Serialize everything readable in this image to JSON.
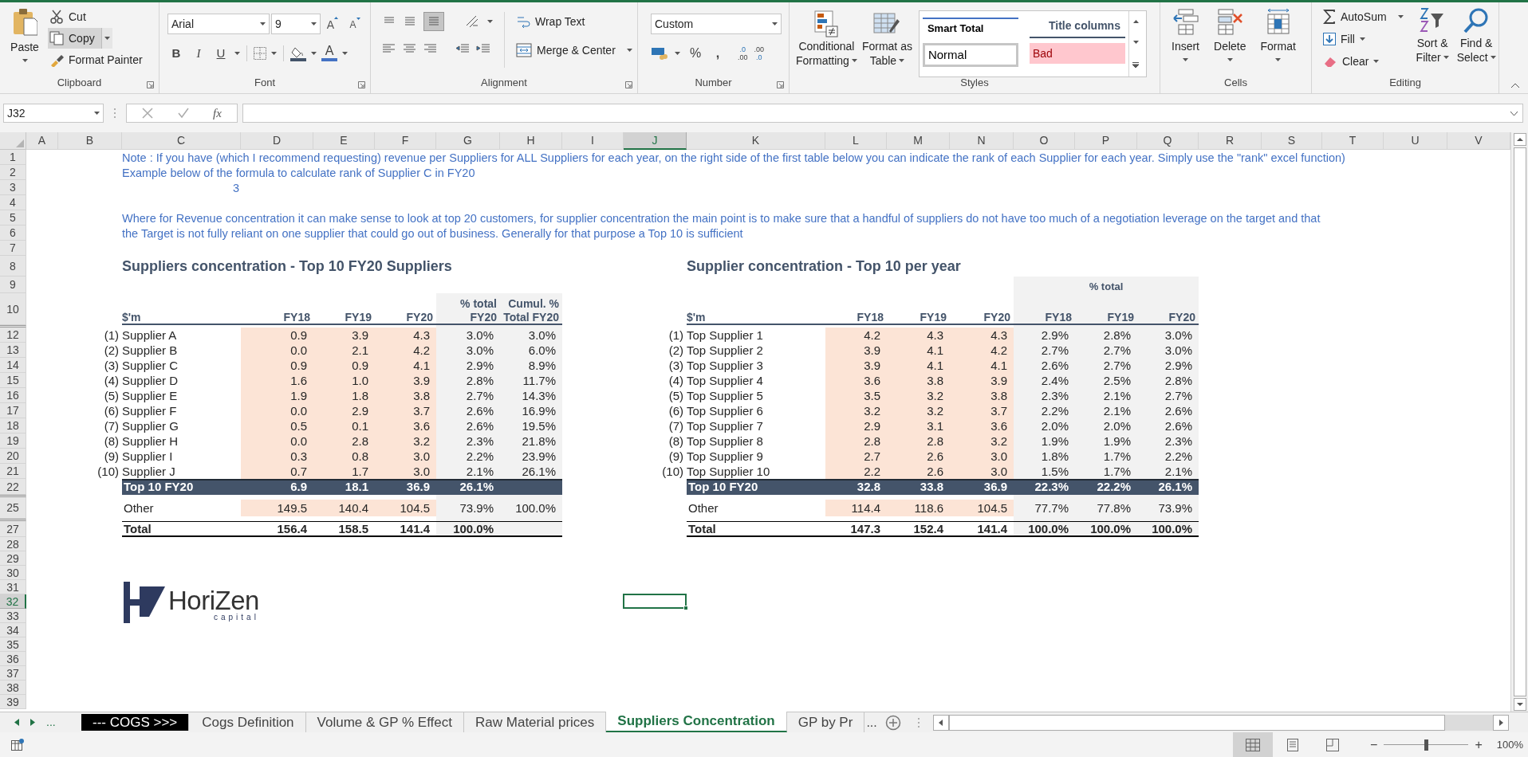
{
  "ribbon": {
    "clipboard": {
      "label": "Clipboard",
      "paste": "Paste",
      "cut": "Cut",
      "copy": "Copy",
      "format_painter": "Format Painter"
    },
    "font": {
      "label": "Font",
      "font_name": "Arial",
      "font_size": "9",
      "grow": "A",
      "shrink": "A",
      "bold": "B",
      "italic": "I",
      "underline": "U",
      "font_color": "A"
    },
    "alignment": {
      "label": "Alignment",
      "wrap_text": "Wrap Text",
      "merge_center": "Merge & Center"
    },
    "number": {
      "label": "Number",
      "format": "Custom",
      "percent": "%",
      "comma": ",",
      "increase_decimal": [
        ".0",
        ".00"
      ],
      "decrease_decimal": [
        ".00",
        ".0"
      ]
    },
    "styles": {
      "label": "Styles",
      "conditional_formatting": [
        "Conditional",
        "Formatting"
      ],
      "format_as_table": [
        "Format as",
        "Table"
      ],
      "gallery": [
        {
          "label": "Smart Total",
          "kind": "smart_total"
        },
        {
          "label": "Title columns",
          "kind": "title"
        },
        {
          "label": "Normal",
          "kind": "normal"
        },
        {
          "label": "Bad",
          "kind": "bad"
        }
      ]
    },
    "cells": {
      "label": "Cells",
      "buttons": [
        "Insert",
        "Delete",
        "Format"
      ]
    },
    "editing": {
      "label": "Editing",
      "autosum": "AutoSum",
      "fill": "Fill",
      "clear": "Clear",
      "sort_filter": [
        "Sort &",
        "Filter"
      ],
      "find_select": [
        "Find &",
        "Select"
      ]
    }
  },
  "formula_bar": {
    "name_box": "J32",
    "fx": "fx"
  },
  "column_headers": [
    {
      "label": "A",
      "selected": false
    },
    {
      "label": "B",
      "selected": false
    },
    {
      "label": "C",
      "selected": false
    },
    {
      "label": "D",
      "selected": false
    },
    {
      "label": "E",
      "selected": false
    },
    {
      "label": "F",
      "selected": false
    },
    {
      "label": "G",
      "selected": false
    },
    {
      "label": "H",
      "selected": false
    },
    {
      "label": "I",
      "selected": false
    },
    {
      "label": "J",
      "selected": true
    },
    {
      "label": "K",
      "selected": false
    },
    {
      "label": "L",
      "selected": false
    },
    {
      "label": "M",
      "selected": false
    },
    {
      "label": "N",
      "selected": false
    },
    {
      "label": "O",
      "selected": false
    },
    {
      "label": "P",
      "selected": false
    },
    {
      "label": "Q",
      "selected": false
    },
    {
      "label": "R",
      "selected": false
    },
    {
      "label": "S",
      "selected": false
    },
    {
      "label": "T",
      "selected": false
    },
    {
      "label": "U",
      "selected": false
    },
    {
      "label": "V",
      "selected": false
    }
  ],
  "row_headers": [
    {
      "label": "1",
      "selected": false,
      "hidden_before": false
    },
    {
      "label": "2",
      "selected": false,
      "hidden_before": false
    },
    {
      "label": "3",
      "selected": false,
      "hidden_before": false
    },
    {
      "label": "4",
      "selected": false,
      "hidden_before": false
    },
    {
      "label": "5",
      "selected": false,
      "hidden_before": false
    },
    {
      "label": "6",
      "selected": false,
      "hidden_before": false
    },
    {
      "label": "7",
      "selected": false,
      "hidden_before": false
    },
    {
      "label": "8",
      "selected": false,
      "hidden_before": false
    },
    {
      "label": "9",
      "selected": false,
      "hidden_before": false
    },
    {
      "label": "10",
      "selected": false,
      "hidden_before": false
    },
    {
      "label": "12",
      "selected": false,
      "hidden_before": true
    },
    {
      "label": "13",
      "selected": false,
      "hidden_before": false
    },
    {
      "label": "14",
      "selected": false,
      "hidden_before": false
    },
    {
      "label": "15",
      "selected": false,
      "hidden_before": false
    },
    {
      "label": "16",
      "selected": false,
      "hidden_before": false
    },
    {
      "label": "17",
      "selected": false,
      "hidden_before": false
    },
    {
      "label": "18",
      "selected": false,
      "hidden_before": false
    },
    {
      "label": "19",
      "selected": false,
      "hidden_before": false
    },
    {
      "label": "20",
      "selected": false,
      "hidden_before": false
    },
    {
      "label": "21",
      "selected": false,
      "hidden_before": false
    },
    {
      "label": "22",
      "selected": false,
      "hidden_before": false
    },
    {
      "label": "25",
      "selected": false,
      "hidden_before": true
    },
    {
      "label": "27",
      "selected": false,
      "hidden_before": true
    },
    {
      "label": "28",
      "selected": false,
      "hidden_before": false
    },
    {
      "label": "29",
      "selected": false,
      "hidden_before": false
    },
    {
      "label": "30",
      "selected": false,
      "hidden_before": false
    },
    {
      "label": "31",
      "selected": false,
      "hidden_before": false
    },
    {
      "label": "32",
      "selected": true,
      "hidden_before": false
    },
    {
      "label": "33",
      "selected": false,
      "hidden_before": false
    },
    {
      "label": "34",
      "selected": false,
      "hidden_before": false
    },
    {
      "label": "35",
      "selected": false,
      "hidden_before": false
    },
    {
      "label": "36",
      "selected": false,
      "hidden_before": false
    },
    {
      "label": "37",
      "selected": false,
      "hidden_before": false
    },
    {
      "label": "38",
      "selected": false,
      "hidden_before": false
    },
    {
      "label": "39",
      "selected": false,
      "hidden_before": false
    }
  ],
  "notes": [
    {
      "text": "Note : If you have (which I recommend requesting) revenue per Suppliers for ALL Suppliers for each year, on the right side of the first table below you can indicate the rank of each Supplier for each year. Simply use the \"rank\" excel function)",
      "kind": "text"
    },
    {
      "text": "Example below of the formula to calculate rank of Supplier C in FY20",
      "kind": "text"
    },
    {
      "text": "3",
      "kind": "number"
    },
    {
      "text": "Where for Revenue concentration it can make sense to look at top 20 customers, for supplier concentration the main point is to make sure that a handful of suppliers do not have too much of a negotiation leverage on the target and that",
      "kind": "text"
    },
    {
      "text": "the Target is not fully reliant on one supplier that could go out of business. Generally for that purpose a Top 10 is sufficient",
      "kind": "text"
    }
  ],
  "left_table": {
    "title": "Suppliers concentration - Top 10 FY20 Suppliers",
    "columns": [
      "$'m",
      "FY18",
      "FY19",
      "FY20",
      "% total\nFY20",
      "Cumul. %\nTotal FY20"
    ],
    "rows": [
      {
        "rank": "(1)",
        "name": "Supplier A",
        "values": [
          "0.9",
          "3.9",
          "4.3",
          "3.0%",
          "3.0%"
        ]
      },
      {
        "rank": "(2)",
        "name": "Supplier B",
        "values": [
          "0.0",
          "2.1",
          "4.2",
          "3.0%",
          "6.0%"
        ]
      },
      {
        "rank": "(3)",
        "name": "Supplier C",
        "values": [
          "0.9",
          "0.9",
          "4.1",
          "2.9%",
          "8.9%"
        ]
      },
      {
        "rank": "(4)",
        "name": "Supplier D",
        "values": [
          "1.6",
          "1.0",
          "3.9",
          "2.8%",
          "11.7%"
        ]
      },
      {
        "rank": "(5)",
        "name": "Supplier E",
        "values": [
          "1.9",
          "1.8",
          "3.8",
          "2.7%",
          "14.3%"
        ]
      },
      {
        "rank": "(6)",
        "name": "Supplier F",
        "values": [
          "0.0",
          "2.9",
          "3.7",
          "2.6%",
          "16.9%"
        ]
      },
      {
        "rank": "(7)",
        "name": "Supplier G",
        "values": [
          "0.5",
          "0.1",
          "3.6",
          "2.6%",
          "19.5%"
        ]
      },
      {
        "rank": "(8)",
        "name": "Supplier H",
        "values": [
          "0.0",
          "2.8",
          "3.2",
          "2.3%",
          "21.8%"
        ]
      },
      {
        "rank": "(9)",
        "name": "Supplier I",
        "values": [
          "0.3",
          "0.8",
          "3.0",
          "2.2%",
          "23.9%"
        ]
      },
      {
        "rank": "(10)",
        "name": "Supplier J",
        "values": [
          "0.7",
          "1.7",
          "3.0",
          "2.1%",
          "26.1%"
        ]
      }
    ],
    "top10": {
      "label": "Top 10 FY20",
      "values": [
        "6.9",
        "18.1",
        "36.9",
        "26.1%"
      ]
    },
    "other": {
      "label": "Other",
      "values": [
        "149.5",
        "140.4",
        "104.5",
        "73.9%",
        "100.0%"
      ]
    },
    "total": {
      "label": "Total",
      "values": [
        "156.4",
        "158.5",
        "141.4",
        "100.0%"
      ]
    }
  },
  "right_table": {
    "title": "Supplier concentration - Top 10 per year",
    "group_header": "% total",
    "columns": [
      "$'m",
      "FY18",
      "FY19",
      "FY20",
      "FY18",
      "FY19",
      "FY20"
    ],
    "rows": [
      {
        "rank": "(1)",
        "name": "Top Supplier 1",
        "values": [
          "4.2",
          "4.3",
          "4.3",
          "2.9%",
          "2.8%",
          "3.0%"
        ]
      },
      {
        "rank": "(2)",
        "name": "Top Supplier 2",
        "values": [
          "3.9",
          "4.1",
          "4.2",
          "2.7%",
          "2.7%",
          "3.0%"
        ]
      },
      {
        "rank": "(3)",
        "name": "Top Supplier 3",
        "values": [
          "3.9",
          "4.1",
          "4.1",
          "2.6%",
          "2.7%",
          "2.9%"
        ]
      },
      {
        "rank": "(4)",
        "name": "Top Supplier 4",
        "values": [
          "3.6",
          "3.8",
          "3.9",
          "2.4%",
          "2.5%",
          "2.8%"
        ]
      },
      {
        "rank": "(5)",
        "name": "Top Supplier 5",
        "values": [
          "3.5",
          "3.2",
          "3.8",
          "2.3%",
          "2.1%",
          "2.7%"
        ]
      },
      {
        "rank": "(6)",
        "name": "Top Supplier 6",
        "values": [
          "3.2",
          "3.2",
          "3.7",
          "2.2%",
          "2.1%",
          "2.6%"
        ]
      },
      {
        "rank": "(7)",
        "name": "Top Supplier 7",
        "values": [
          "2.9",
          "3.1",
          "3.6",
          "2.0%",
          "2.0%",
          "2.6%"
        ]
      },
      {
        "rank": "(8)",
        "name": "Top Supplier 8",
        "values": [
          "2.8",
          "2.8",
          "3.2",
          "1.9%",
          "1.9%",
          "2.3%"
        ]
      },
      {
        "rank": "(9)",
        "name": "Top Supplier 9",
        "values": [
          "2.7",
          "2.6",
          "3.0",
          "1.8%",
          "1.7%",
          "2.2%"
        ]
      },
      {
        "rank": "(10)",
        "name": "Top Supplier 10",
        "values": [
          "2.2",
          "2.6",
          "3.0",
          "1.5%",
          "1.7%",
          "2.1%"
        ]
      }
    ],
    "top10": {
      "label": "Top 10 FY20",
      "values": [
        "32.8",
        "33.8",
        "36.9",
        "22.3%",
        "22.2%",
        "26.1%"
      ]
    },
    "other": {
      "label": "Other",
      "values": [
        "114.4",
        "118.6",
        "104.5",
        "77.7%",
        "77.8%",
        "73.9%"
      ]
    },
    "total": {
      "label": "Total",
      "values": [
        "147.3",
        "152.4",
        "141.4",
        "100.0%",
        "100.0%",
        "100.0%"
      ]
    }
  },
  "logo": {
    "name": "HoriZen",
    "tagline": "capital"
  },
  "sheet_tabs": {
    "more_left": "...",
    "tabs": [
      {
        "label": "--- COGS >>>",
        "selected": false,
        "color": "#000000"
      },
      {
        "label": "Cogs Definition",
        "selected": false
      },
      {
        "label": "Volume & GP % Effect",
        "selected": false
      },
      {
        "label": "Raw Material prices",
        "selected": false
      },
      {
        "label": "Suppliers Concentration",
        "selected": true
      },
      {
        "label": "GP by Pr",
        "selected": false
      }
    ],
    "more_right": "..."
  },
  "status_bar": {
    "views": [
      {
        "kind": "normal",
        "selected": true
      },
      {
        "kind": "page_layout",
        "selected": false
      },
      {
        "kind": "page_break",
        "selected": false
      }
    ],
    "zoom_out": "−",
    "zoom_slider": {
      "level": 0.5
    },
    "zoom_in": "+",
    "zoom": "100%"
  }
}
